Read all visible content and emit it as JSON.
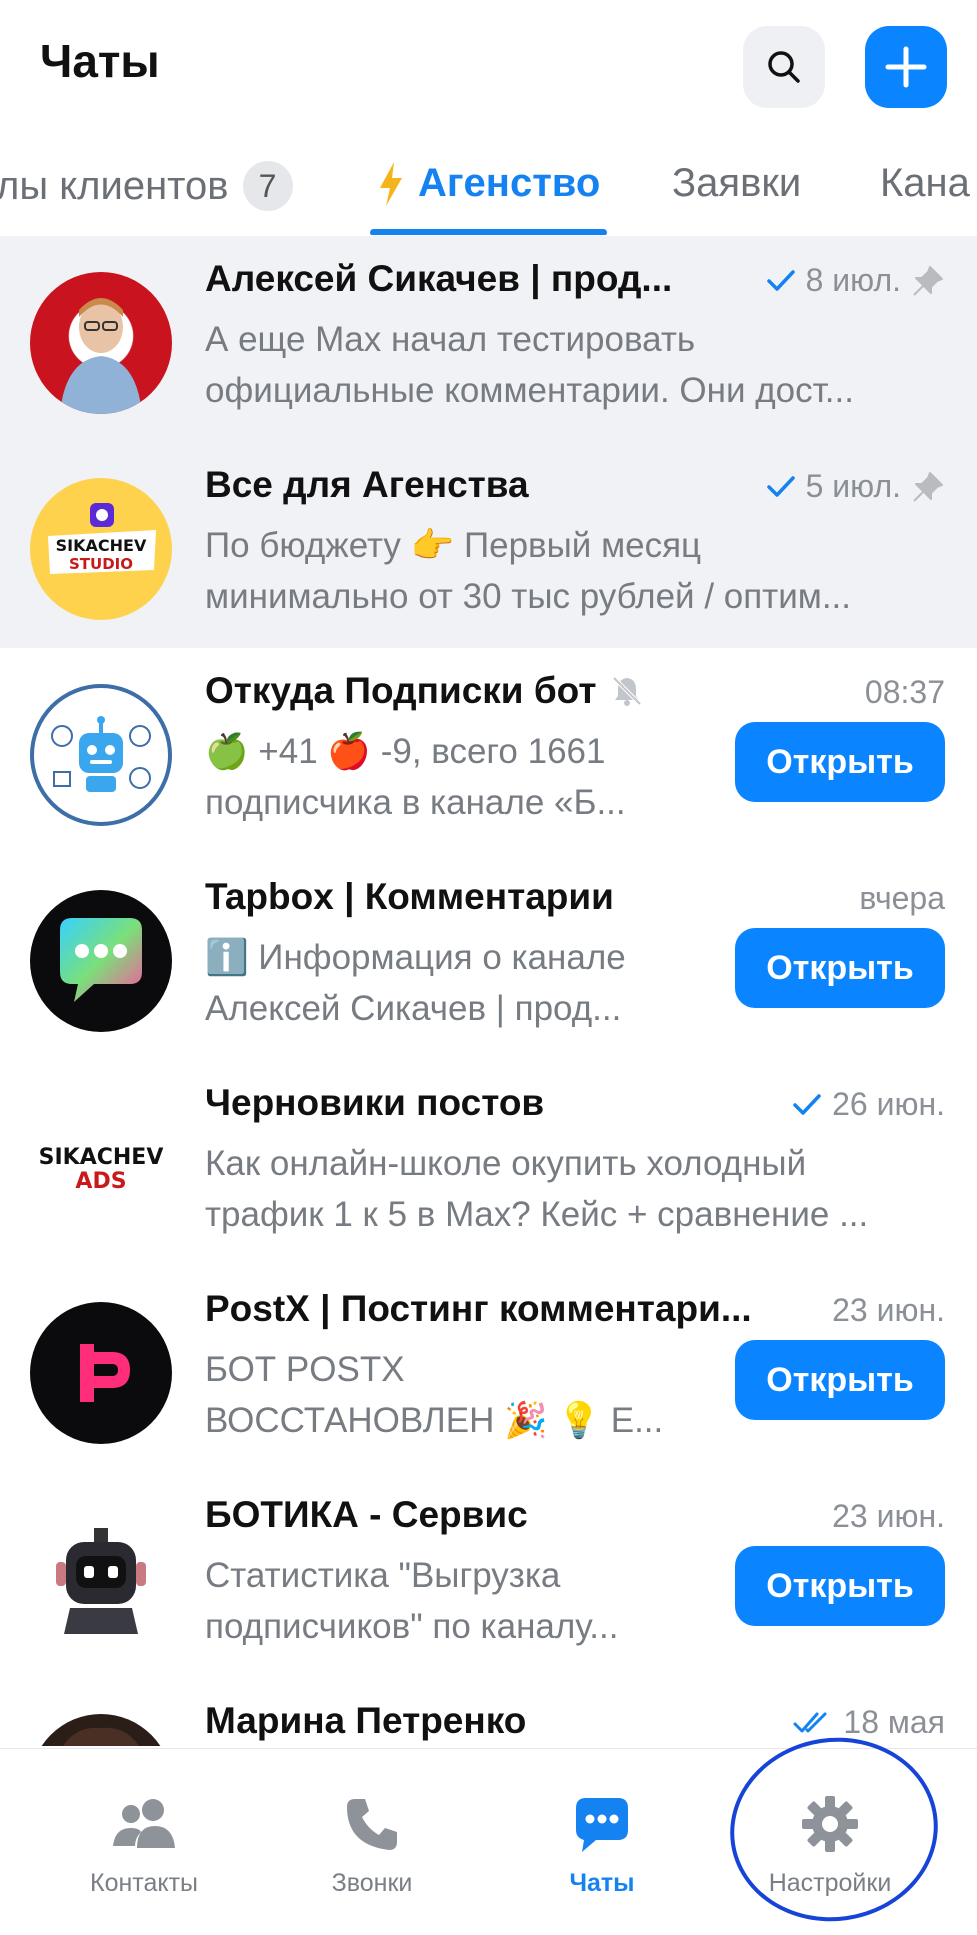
{
  "header": {
    "title": "Чаты"
  },
  "tabs": [
    {
      "label": "лы клиентов",
      "badge": "7"
    },
    {
      "label": "Агенство",
      "icon": "lightning-icon",
      "active": true
    },
    {
      "label": "Заявки"
    },
    {
      "label": "Кана"
    }
  ],
  "chats": [
    {
      "name": "Алексей Сикачев | прод...",
      "time": "8 июл.",
      "read": "single-check",
      "pinned": true,
      "line1": "А еще Max начал тестировать",
      "line2": "официальные комментарии. Они дост..."
    },
    {
      "name": "Все для Агенства",
      "time": "5 июл.",
      "read": "single-check",
      "pinned": true,
      "line1": "По бюджету 👉 Первый месяц",
      "line2": "минимально от 30 тыс рублей / оптим...",
      "avatar_text": [
        "SIKACHEV",
        "STUDIO"
      ]
    },
    {
      "name": "Откуда Подписки бот",
      "time": "08:37",
      "muted": true,
      "button": "Открыть",
      "line1": "🍏 +41 🍎 -9, всего 1661",
      "line2": "подписчика в канале «Б..."
    },
    {
      "name": "Tapbox | Комментарии",
      "time": "вчера",
      "button": "Открыть",
      "line1": "ℹ️ Информация о канале",
      "line2": "Алексей Сикачев | прод..."
    },
    {
      "name": "Черновики постов",
      "time": "26 июн.",
      "read": "single-check",
      "line1": "Как онлайн-школе окупить холодный",
      "line2": "трафик 1 к 5 в Max? Кейс + сравнение ...",
      "avatar_text": [
        "SIKACHEV",
        "ADS"
      ]
    },
    {
      "name": "PostX | Постинг комментари...",
      "time": "23 июн.",
      "button": "Открыть",
      "line1": "БОТ POSTX",
      "line2": "ВОССТАНОВЛЕН 🎉 💡 Е..."
    },
    {
      "name": "БОТИКА - Сервис",
      "time": "23 июн.",
      "button": "Открыть",
      "line1": "Статистика \"Выгрузка",
      "line2": "подписчиков\" по каналу..."
    },
    {
      "name": "Марина Петренко",
      "time": "18 мая",
      "read": "double-check",
      "line1": "",
      "line2": ""
    }
  ],
  "nav": [
    {
      "label": "Контакты",
      "icon": "contacts-icon"
    },
    {
      "label": "Звонки",
      "icon": "phone-icon"
    },
    {
      "label": "Чаты",
      "icon": "chat-icon",
      "active": true
    },
    {
      "label": "Настройки",
      "icon": "gear-icon"
    }
  ],
  "colors": {
    "accent": "#0a84ff",
    "tab_active": "#1582f1",
    "pinned_bg": "#f1f2f5",
    "annotation": "#1643d8"
  }
}
